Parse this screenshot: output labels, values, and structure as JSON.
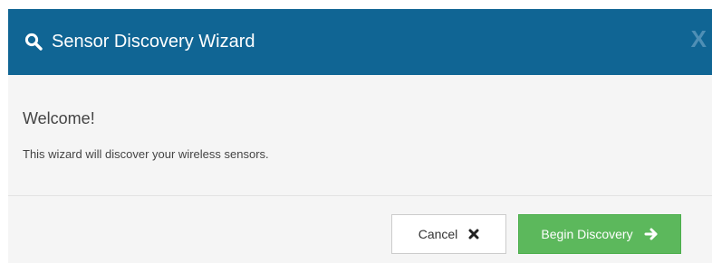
{
  "dialog": {
    "title": "Sensor Discovery Wizard",
    "title_icon": "search-icon",
    "close_label": "X"
  },
  "body": {
    "welcome": "Welcome!",
    "description": "This wizard will discover your wireless sensors."
  },
  "footer": {
    "cancel_label": "Cancel",
    "cancel_icon": "close-icon",
    "begin_label": "Begin Discovery",
    "begin_icon": "arrow-right-icon"
  },
  "colors": {
    "header_bg": "#106594",
    "body_bg": "#f5f5f5",
    "primary_button": "#5cb85c"
  }
}
